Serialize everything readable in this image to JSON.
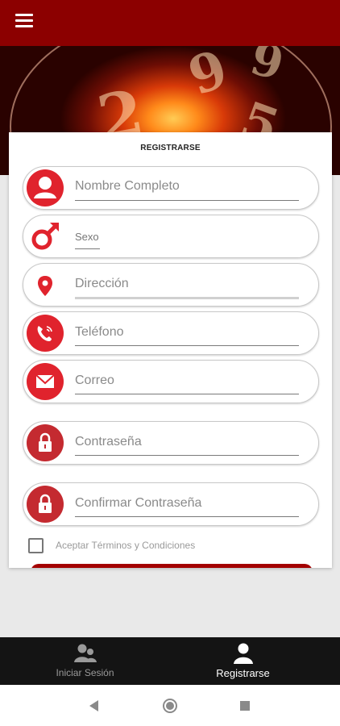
{
  "app": {
    "menu_icon": "hamburger-menu-icon",
    "brand_color": "#8c0000"
  },
  "banner": {
    "digits": [
      "9",
      "9",
      "2",
      "5"
    ]
  },
  "form": {
    "title": "REGISTRARSE",
    "fields": [
      {
        "name": "full-name",
        "icon": "user-icon",
        "placeholder": "Nombre Completo"
      },
      {
        "name": "sex",
        "icon": "male-symbol-icon",
        "value": "Sexo"
      },
      {
        "name": "address",
        "icon": "location-pin-icon",
        "placeholder": "Dirección"
      },
      {
        "name": "phone",
        "icon": "phone-icon",
        "placeholder": "Teléfono"
      },
      {
        "name": "email",
        "icon": "mail-icon",
        "placeholder": "Correo"
      },
      {
        "name": "password",
        "icon": "lock-icon",
        "placeholder": "Contraseña"
      },
      {
        "name": "confirm-password",
        "icon": "lock-icon",
        "placeholder": "Confirmar Contraseña"
      }
    ],
    "terms_label": "Aceptar Términos y Condiciones",
    "terms_checked": false
  },
  "bottom_nav": {
    "items": [
      {
        "label": "Iniciar Sesión",
        "icon": "users-icon",
        "active": false
      },
      {
        "label": "Registrarse",
        "icon": "user-icon",
        "active": true
      }
    ]
  },
  "system_nav": {
    "back": "back-icon",
    "home": "home-icon",
    "recents": "recents-icon"
  }
}
